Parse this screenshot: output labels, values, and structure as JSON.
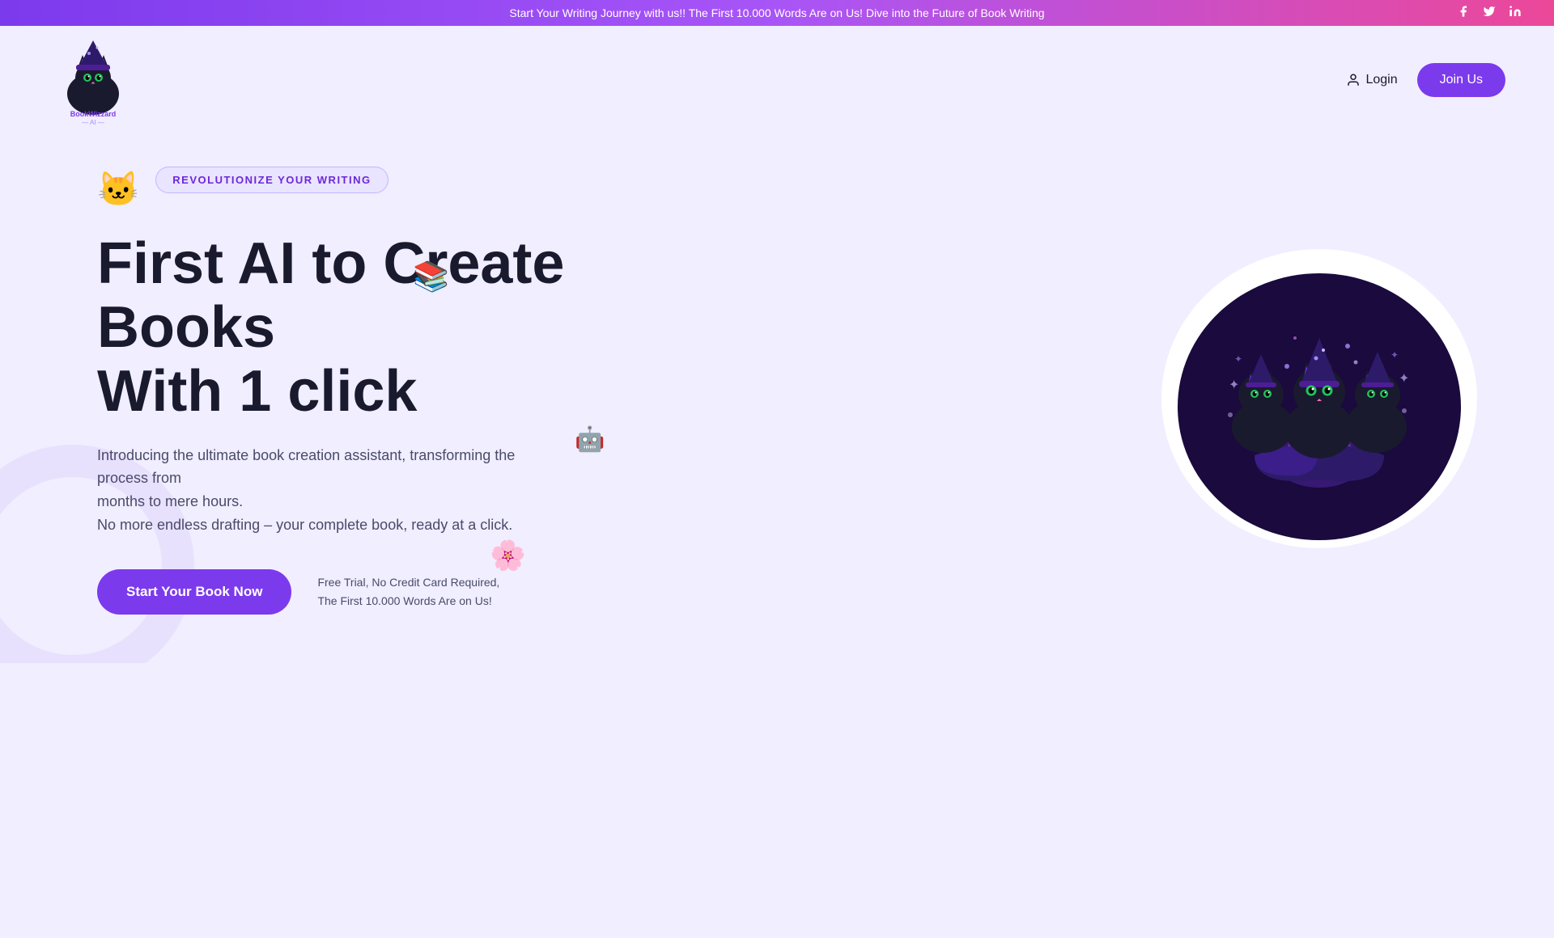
{
  "banner": {
    "text": "Start Your Writing Journey with us!! The First 10.000 Words Are on Us! Dive into the Future of Book Writing",
    "bg_gradient": "linear-gradient(90deg, #7c3aed, #a855f7, #ec4899)"
  },
  "social": {
    "facebook_label": "Facebook",
    "twitter_label": "Twitter",
    "linkedin_label": "LinkedIn"
  },
  "navbar": {
    "logo_alt": "BookWizzard AI",
    "login_label": "Login",
    "join_label": "Join Us"
  },
  "hero": {
    "badge_label": "REVOLUTIONIZE YOUR WRITING",
    "title_line1": "First AI to Create",
    "title_line2": "Books",
    "title_line3": "With 1 click",
    "subtitle_line1": "Introducing the ultimate book creation assistant, transforming the process from",
    "subtitle_line2": "months to mere hours.",
    "subtitle_line3": "No more endless drafting – your complete book, ready at a click.",
    "cta_button": "Start Your Book Now",
    "free_trial_line1": "Free Trial, No Credit Card Required,",
    "free_trial_line2": "The First 10.000 Words Are on Us!",
    "illustration_emoji": "🐱🔮🐱",
    "accent_color": "#7c3aed"
  },
  "floating_icons": {
    "books_icon": "📚",
    "ai_icon": "🤖",
    "circuit_icon": "🌸"
  }
}
